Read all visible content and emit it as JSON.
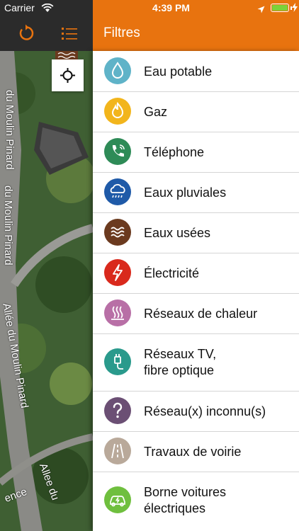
{
  "status_bar": {
    "carrier": "Carrier",
    "time": "4:39 PM"
  },
  "map": {
    "streets": [
      "du Moulin Pinard",
      "du Moulin Pinard",
      "Allée du Moulin Pinard",
      "Allee du",
      "ence"
    ]
  },
  "panel": {
    "title": "Filtres",
    "items": [
      {
        "label": "Eau potable",
        "icon": "water-drop-icon",
        "color": "#5fb3c8"
      },
      {
        "label": "Gaz",
        "icon": "flame-icon",
        "color": "#f2b51c"
      },
      {
        "label": "Téléphone",
        "icon": "phone-icon",
        "color": "#2e8b57"
      },
      {
        "label": "Eaux pluviales",
        "icon": "rain-cloud-icon",
        "color": "#1f5aa8"
      },
      {
        "label": "Eaux usées",
        "icon": "waves-icon",
        "color": "#6b3a1f"
      },
      {
        "label": "Électricité",
        "icon": "lightning-icon",
        "color": "#d9291c"
      },
      {
        "label": "Réseaux de chaleur",
        "icon": "heat-icon",
        "color": "#b86fa6"
      },
      {
        "label": "Réseaux TV,",
        "label2": "fibre optique",
        "icon": "plug-icon",
        "color": "#2a9a8c"
      },
      {
        "label": "Réseau(x) inconnu(s)",
        "icon": "question-icon",
        "color": "#6b4f74"
      },
      {
        "label": "Travaux de voirie",
        "icon": "road-icon",
        "color": "#b9a99a"
      },
      {
        "label": "Borne voitures",
        "label2": "électriques",
        "icon": "ev-car-icon",
        "color": "#6fbf3e"
      }
    ]
  }
}
